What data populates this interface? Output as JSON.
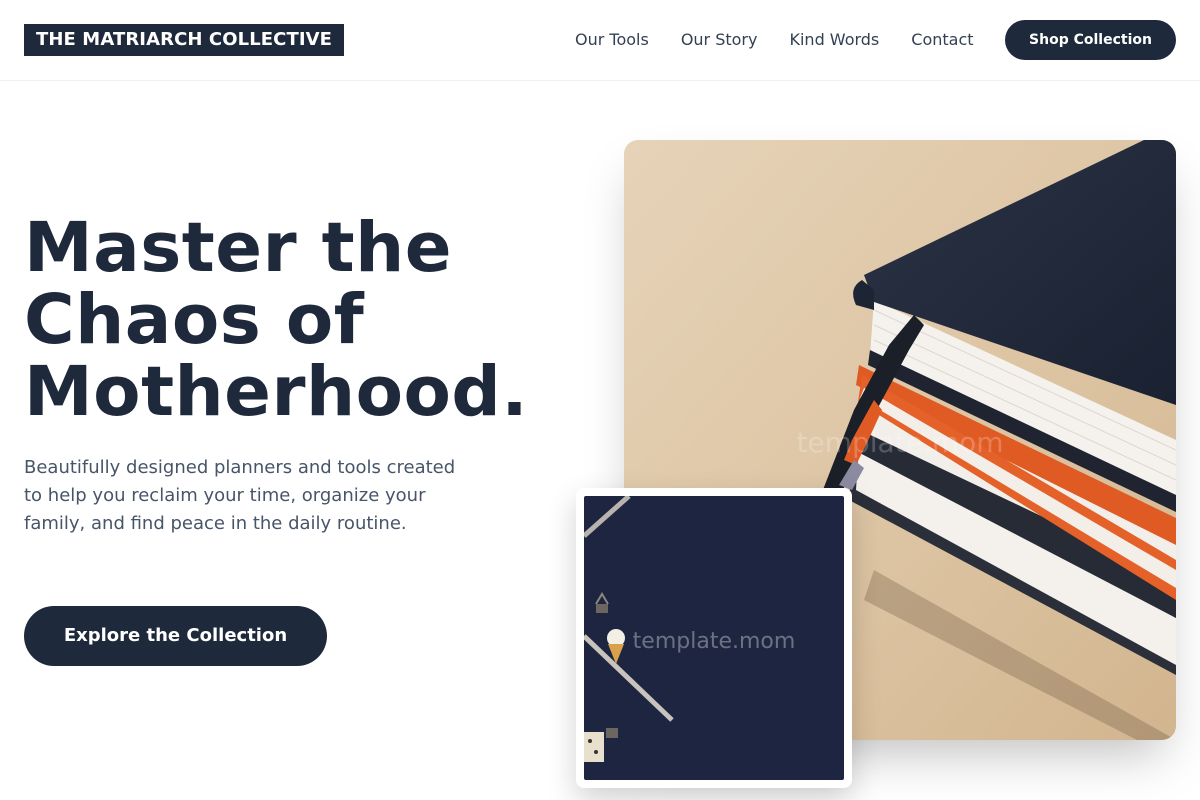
{
  "header": {
    "logo_text": "THE MATRIARCH COLLECTIVE",
    "nav": [
      {
        "label": "Our Tools"
      },
      {
        "label": "Our Story"
      },
      {
        "label": "Kind Words"
      },
      {
        "label": "Contact"
      }
    ],
    "cta_label": "Shop Collection"
  },
  "hero": {
    "title_lines": [
      "Master the",
      "Chaos of",
      "Motherhood."
    ],
    "description": "Beautifully designed planners and tools created to help you reclaim your time, organize your family, and find peace in the daily routine.",
    "cta_label": "Explore the Collection"
  },
  "images": {
    "main_watermark": "template.mom",
    "inset_watermark": "template.mom"
  },
  "colors": {
    "primary": "#1e293b",
    "text_muted": "#475569",
    "background": "#ffffff",
    "tan_surface": "#dcc4a4",
    "navy_surface": "#1d2540",
    "accent_orange": "#e05a24"
  }
}
